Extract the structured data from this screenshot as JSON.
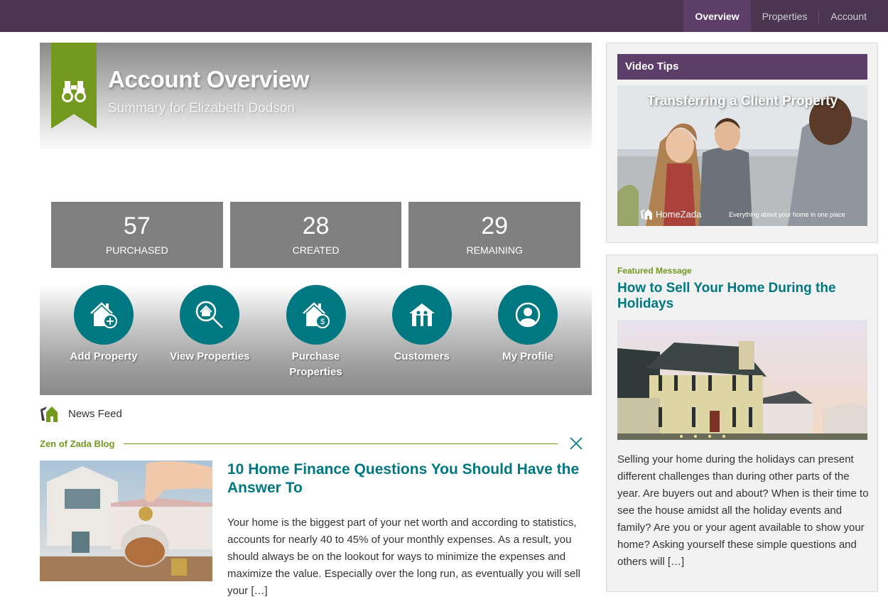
{
  "nav": {
    "items": [
      {
        "label": "Overview",
        "active": true
      },
      {
        "label": "Properties",
        "active": false
      },
      {
        "label": "Account",
        "active": false
      }
    ]
  },
  "hero": {
    "icon": "binoculars-icon",
    "title": "Account Overview",
    "subtitle": "Summary for Elizabeth Dodson"
  },
  "stats": [
    {
      "value": "57",
      "label": "PURCHASED"
    },
    {
      "value": "28",
      "label": "CREATED"
    },
    {
      "value": "29",
      "label": "REMAINING"
    }
  ],
  "actions": [
    {
      "label": "Add Property",
      "icon": "house-plus-icon"
    },
    {
      "label": "View Properties",
      "icon": "house-search-icon"
    },
    {
      "label": "Purchase Properties",
      "icon": "house-dollar-icon"
    },
    {
      "label": "Customers",
      "icon": "house-people-icon"
    },
    {
      "label": "My Profile",
      "icon": "user-profile-icon"
    }
  ],
  "news_feed": {
    "label": "News Feed",
    "source": "Zen of Zada Blog",
    "post": {
      "title": "10 Home Finance Questions You Should Have the Answer To",
      "excerpt": "Your home is the biggest part of your net worth and according to statistics, accounts for nearly 40 to 45% of your monthly expenses. As a result, you should always be on the lookout for ways to minimize the expenses and maximize the value. Especially over the long run, as eventually you will sell your […]"
    }
  },
  "video_tips": {
    "heading": "Video Tips",
    "video_title": "Transferring a Client Property",
    "brand": "HomeZada",
    "tagline": "Everything about your home in one place"
  },
  "featured": {
    "label": "Featured Message",
    "title": "How to Sell Your Home During the Holidays",
    "body": "Selling your home during the holidays can present different challenges than during other parts of the year. Are buyers out and about? When is their time to see the house amidst all the holiday events and family? Are you or your agent available to show your home? Asking yourself these simple questions and others will […]"
  },
  "colors": {
    "nav_bg": "#4a3650",
    "nav_active": "#5d3e69",
    "accent_green": "#739a1e",
    "accent_teal": "#007882",
    "stat_bg": "#808080"
  }
}
